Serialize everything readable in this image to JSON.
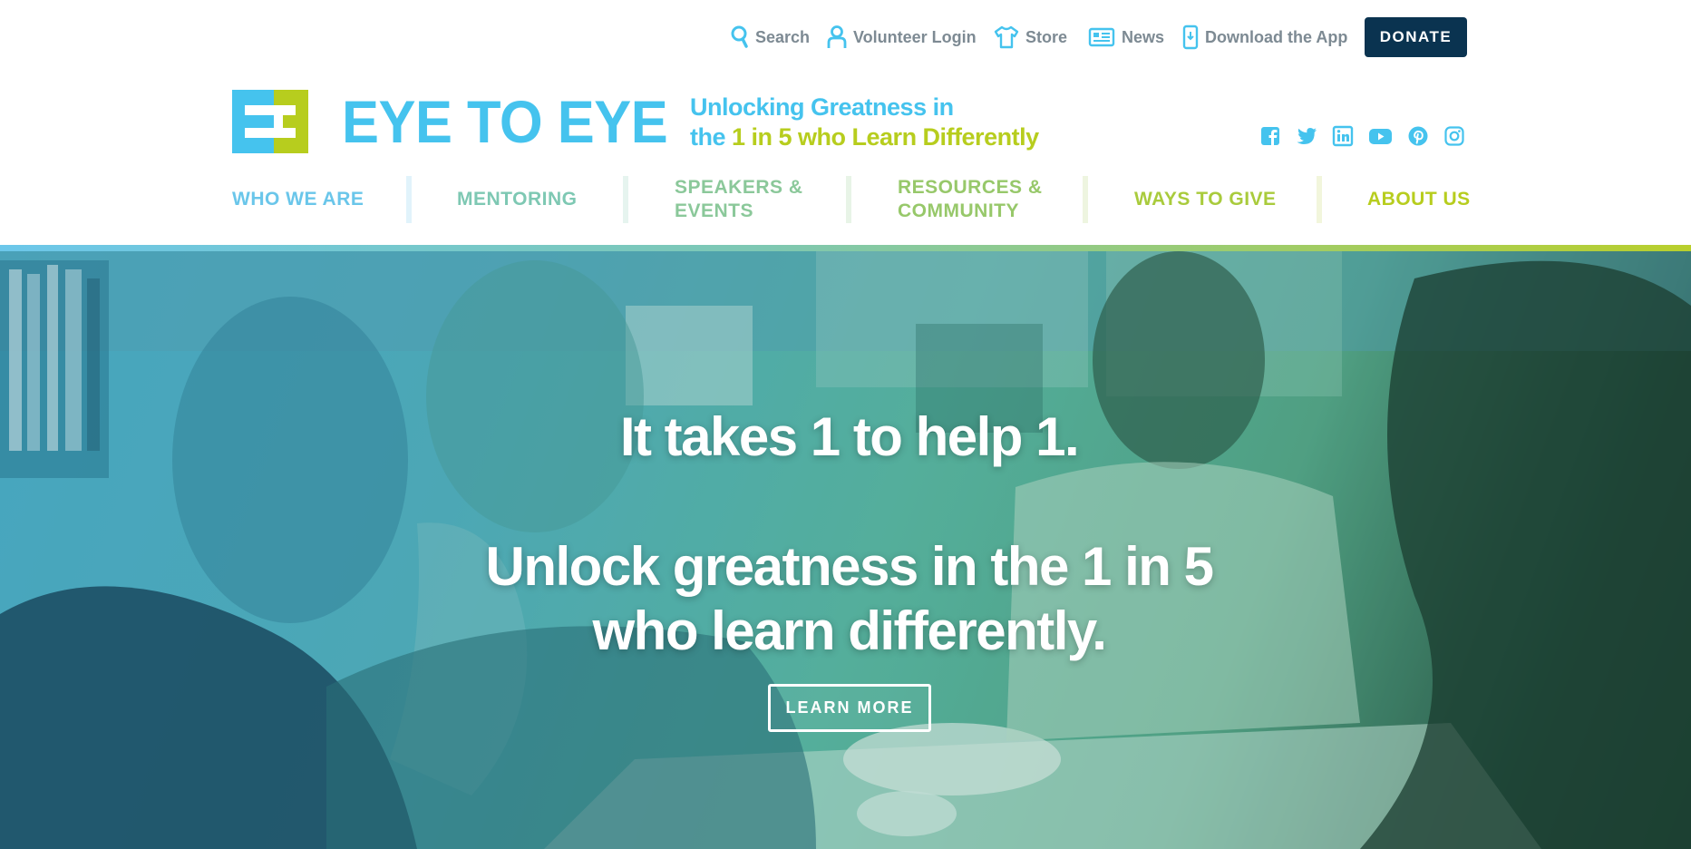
{
  "utility_nav": {
    "search": "Search",
    "volunteer_login": "Volunteer Login",
    "store": "Store",
    "news": "News",
    "download_app": "Download the App",
    "donate": "DONATE"
  },
  "brand": {
    "logo_text": "EYE TO EYE",
    "tagline_line1": "Unlocking Greatness in",
    "tagline_line2_pre": "the ",
    "tagline_line2_highlight": "1 in 5 who Learn Differently",
    "color_blue": "#45c3ee",
    "color_green": "#b7cd1e"
  },
  "social_icons": [
    "facebook-icon",
    "twitter-icon",
    "linkedin-icon",
    "youtube-icon",
    "pinterest-icon",
    "instagram-icon"
  ],
  "main_nav": {
    "who_we_are": "WHO WE ARE",
    "mentoring": "MENTORING",
    "speakers_events_1": "SPEAKERS &",
    "speakers_events_2": "EVENTS",
    "resources_community_1": "RESOURCES &",
    "resources_community_2": "COMMUNITY",
    "ways_to_give": "WAYS TO GIVE",
    "about_us": "ABOUT US"
  },
  "hero": {
    "headline": "It takes 1 to help 1.",
    "subheadline_line1": "Unlock greatness in the 1 in 5",
    "subheadline_line2": "who learn differently.",
    "cta": "LEARN MORE"
  }
}
